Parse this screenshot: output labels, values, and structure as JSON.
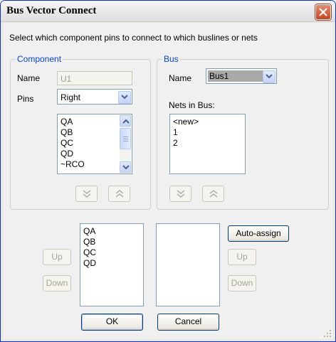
{
  "window": {
    "title": "Bus Vector Connect"
  },
  "instruction": "Select which component pins to connect to which buslines or nets",
  "component": {
    "legend": "Component",
    "name_label": "Name",
    "name_value": "U1",
    "pins_label": "Pins",
    "pins_value": "Right",
    "pin_list": [
      "QA",
      "QB",
      "QC",
      "QD",
      "~RCO"
    ]
  },
  "bus": {
    "legend": "Bus",
    "name_label": "Name",
    "name_value": "Bus1",
    "nets_label": "Nets in Bus:",
    "nets": [
      "<new>",
      "1",
      "2"
    ]
  },
  "assignment": {
    "pins_list": [
      "QA",
      "QB",
      "QC",
      "QD"
    ],
    "nets_list": [],
    "auto_assign_label": "Auto-assign",
    "up_label": "Up",
    "down_label": "Down"
  },
  "buttons": {
    "ok": "OK",
    "cancel": "Cancel"
  },
  "colors": {
    "legend": "#0046d5",
    "title_close": "#c9421c",
    "disabled_text": "#a5a395"
  }
}
